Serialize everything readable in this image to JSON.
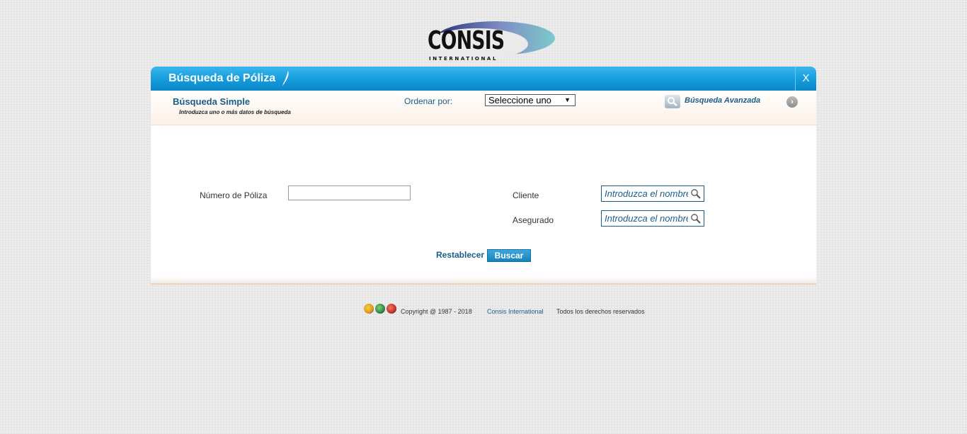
{
  "logo": {
    "text": "CONSIS",
    "subtext": "INTERNATIONAL"
  },
  "panel": {
    "title": "Búsqueda de Póliza",
    "close_label": "X"
  },
  "subbar": {
    "title": "Búsqueda Simple",
    "hint": "Introduzca uno o más datos de búsqueda",
    "order_label": "Ordenar por:",
    "order_value": "Seleccione uno",
    "advanced_label": "Búsqueda Avanzada"
  },
  "form": {
    "policy_number_label": "Número de Póliza",
    "policy_number_value": "",
    "client_label": "Cliente",
    "client_placeholder": "Introduzca el nombre",
    "insured_label": "Asegurado",
    "insured_placeholder": "Introduzca el nombre",
    "reset_label": "Restablecer",
    "search_label": "Buscar"
  },
  "footer": {
    "copyright": "Copyright @ 1987 - 2018",
    "company": "Consis International",
    "rights": "Todos los derechos reservados"
  },
  "colors": {
    "header_blue": "#139bdc",
    "link_blue": "#1a5d8c",
    "accent_border": "#f0d2c0"
  }
}
